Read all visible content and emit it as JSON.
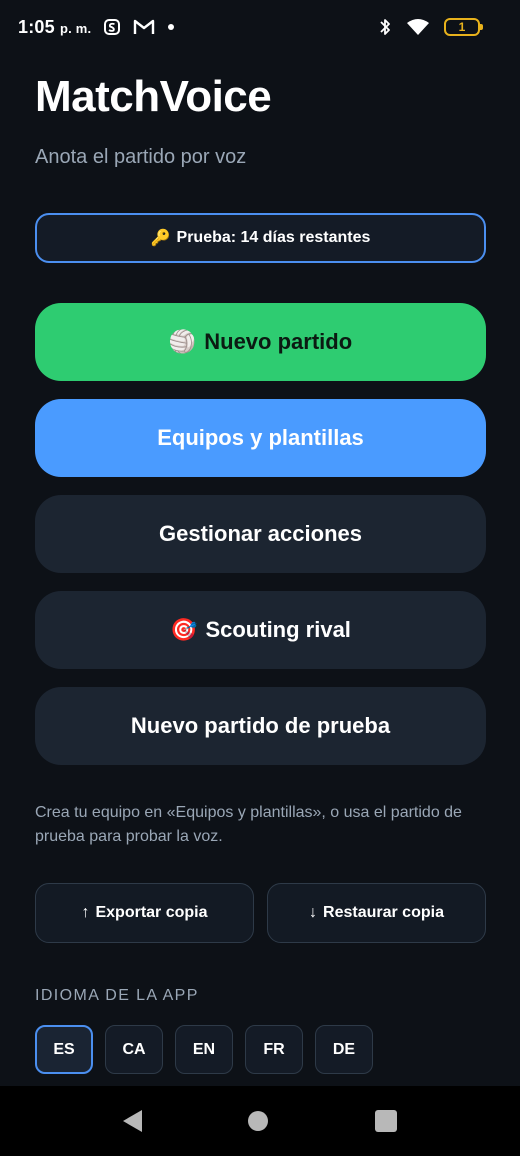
{
  "status_bar": {
    "time": "1:05",
    "ampm": "p. m.",
    "battery_level": "1",
    "icons": [
      "app-s-icon",
      "gmail-icon",
      "dot-icon",
      "bluetooth-icon",
      "wifi-icon",
      "battery-icon"
    ]
  },
  "app": {
    "title": "MatchVoice",
    "subtitle": "Anota el partido por voz"
  },
  "trial": {
    "icon": "🔑",
    "label": "Prueba: 14 días restantes"
  },
  "buttons": {
    "new_match": {
      "icon": "🏐",
      "label": "Nuevo partido"
    },
    "teams": {
      "label": "Equipos y plantillas"
    },
    "actions": {
      "label": "Gestionar acciones"
    },
    "scouting": {
      "icon": "🎯",
      "label": "Scouting rival"
    },
    "test_match": {
      "label": "Nuevo partido de prueba"
    }
  },
  "hint": "Crea tu equipo en «Equipos y plantillas», o usa el partido de prueba para probar la voz.",
  "backup": {
    "export": {
      "icon": "↑",
      "label": "Exportar copia"
    },
    "restore": {
      "icon": "↓",
      "label": "Restaurar copia"
    }
  },
  "language": {
    "section_label": "IDIOMA DE LA APP",
    "options": [
      "ES",
      "CA",
      "EN",
      "FR",
      "DE"
    ],
    "selected": "ES"
  },
  "colors": {
    "background": "#0d1117",
    "primary_green": "#2ecc71",
    "primary_blue": "#4a9bff",
    "card_dark": "#1c2531",
    "accent_border": "#4b8ff0",
    "battery_warning": "#e8b21c"
  }
}
